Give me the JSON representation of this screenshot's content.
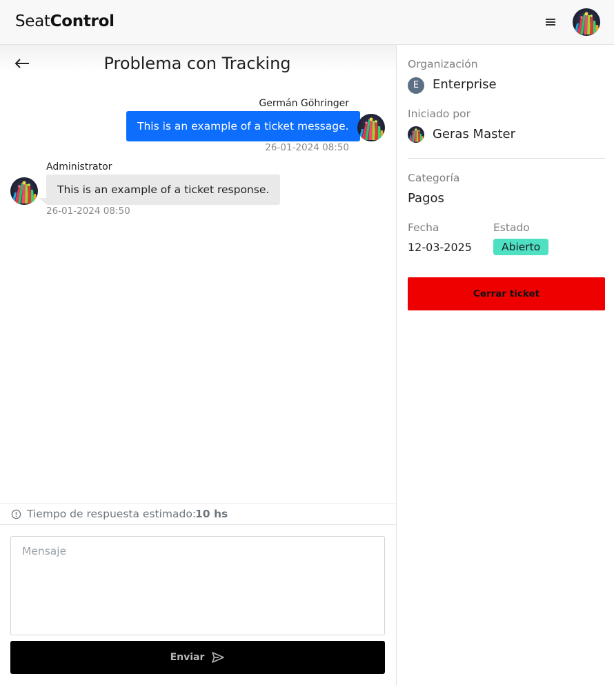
{
  "header": {
    "brand_light": "Seat",
    "brand_bold": "Control",
    "menu_icon": "hamburger-menu-icon",
    "avatar": "user-avatar"
  },
  "chat": {
    "title": "Problema con Tracking",
    "back_icon": "arrow-left-icon",
    "messages": [
      {
        "author": "Germán Göhringer",
        "text": "This is an example of a ticket message.",
        "time": "26-01-2024 08:50",
        "direction": "outgoing",
        "color": "#0d6efd"
      },
      {
        "author": "Administrator",
        "text": "This is an example of a ticket response.",
        "time": "26-01-2024 08:50",
        "direction": "incoming",
        "color": "#e9e9e9"
      }
    ],
    "eta": {
      "icon": "info-circle-icon",
      "label": "Tiempo de respuesta estimado:",
      "value": "10 hs"
    },
    "input": {
      "placeholder": "Mensaje",
      "value": ""
    },
    "send": {
      "label": "Enviar",
      "icon": "send-icon"
    }
  },
  "info": {
    "organization": {
      "label": "Organización",
      "initial": "E",
      "value": "Enterprise"
    },
    "started_by": {
      "label": "Iniciado por",
      "value": "Geras Master"
    },
    "category": {
      "label": "Categoría",
      "value": "Pagos"
    },
    "date": {
      "label": "Fecha",
      "value": "12-03-2025"
    },
    "status": {
      "label": "Estado",
      "value": "Abierto",
      "color": "#4fe0c4"
    },
    "close_button": {
      "label": "Cerrar ticket",
      "color": "#ef0000"
    }
  }
}
